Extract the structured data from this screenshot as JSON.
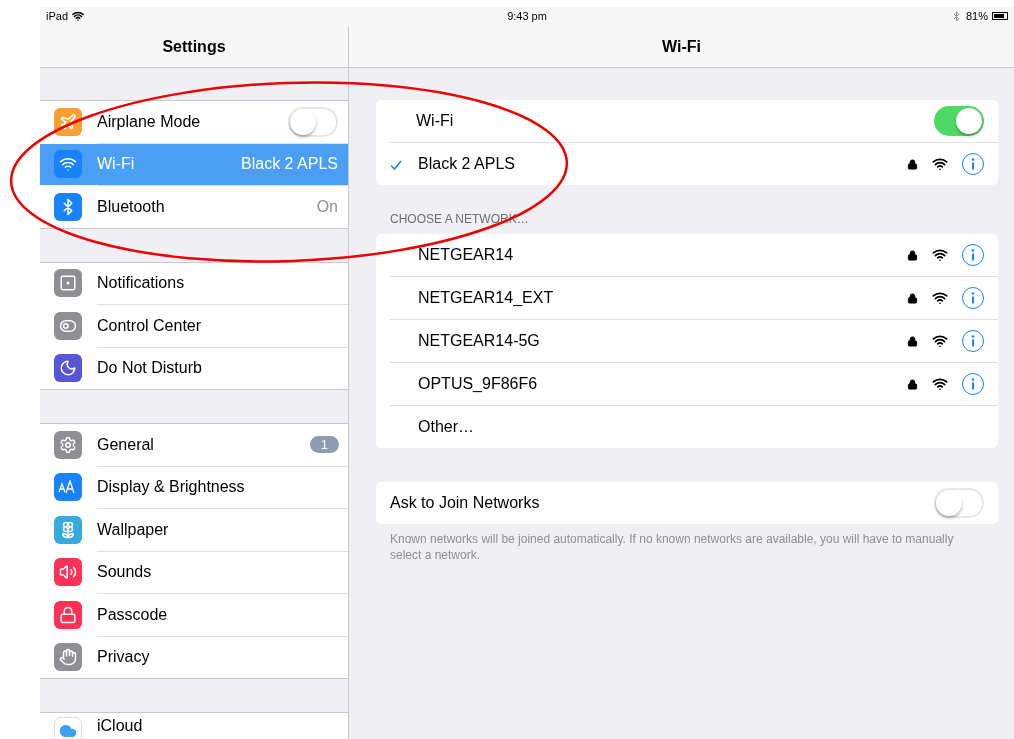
{
  "status_bar": {
    "device": "iPad",
    "time": "9:43 pm",
    "battery": "81%"
  },
  "sidebar": {
    "title": "Settings",
    "groups": [
      {
        "items": [
          {
            "label": "Airplane Mode",
            "kind": "toggle",
            "on": false,
            "selected": false,
            "color": "#f8a033"
          },
          {
            "label": "Wi-Fi",
            "kind": "value",
            "value": "Black 2 APLS",
            "selected": true,
            "color": "#1a82fb"
          },
          {
            "label": "Bluetooth",
            "kind": "value",
            "value": "On",
            "selected": false,
            "color": "#1a82fb"
          }
        ]
      },
      {
        "items": [
          {
            "label": "Notifications",
            "kind": "plain",
            "selected": false,
            "color": "#8e8e93"
          },
          {
            "label": "Control Center",
            "kind": "plain",
            "selected": false,
            "color": "#8e8e93"
          },
          {
            "label": "Do Not Disturb",
            "kind": "plain",
            "selected": false,
            "color": "#5856d6"
          }
        ]
      },
      {
        "items": [
          {
            "label": "General",
            "kind": "badge",
            "badge": "1",
            "selected": false,
            "color": "#8e8e93"
          },
          {
            "label": "Display & Brightness",
            "kind": "plain",
            "selected": false,
            "color": "#1a82fb"
          },
          {
            "label": "Wallpaper",
            "kind": "plain",
            "selected": false,
            "color": "#35aadc"
          },
          {
            "label": "Sounds",
            "kind": "plain",
            "selected": false,
            "color": "#fc3158"
          },
          {
            "label": "Passcode",
            "kind": "plain",
            "selected": false,
            "color": "#fc3158"
          },
          {
            "label": "Privacy",
            "kind": "plain",
            "selected": false,
            "color": "#8e8e93"
          }
        ]
      },
      {
        "items": [
          {
            "label": "iCloud",
            "kind": "plain",
            "selected": false,
            "color": "#ffffff"
          }
        ]
      }
    ]
  },
  "detail": {
    "title": "Wi-Fi",
    "wifi_toggle": {
      "label": "Wi-Fi",
      "on": true
    },
    "connected": {
      "name": "Black 2 APLS",
      "locked": true
    },
    "section_header": "CHOOSE A NETWORK…",
    "networks": [
      {
        "kind": "network",
        "name": "NETGEAR14",
        "locked": true
      },
      {
        "kind": "network",
        "name": "NETGEAR14_EXT",
        "locked": true
      },
      {
        "kind": "network",
        "name": "NETGEAR14-5G",
        "locked": true
      },
      {
        "kind": "network",
        "name": "OPTUS_9F86F6",
        "locked": true
      },
      {
        "kind": "other",
        "name": "Other…"
      }
    ],
    "ask_to_join": {
      "label": "Ask to Join Networks",
      "on": false
    },
    "footer": "Known networks will be joined automatically. If no known networks are available, you will have to manually select a network."
  }
}
